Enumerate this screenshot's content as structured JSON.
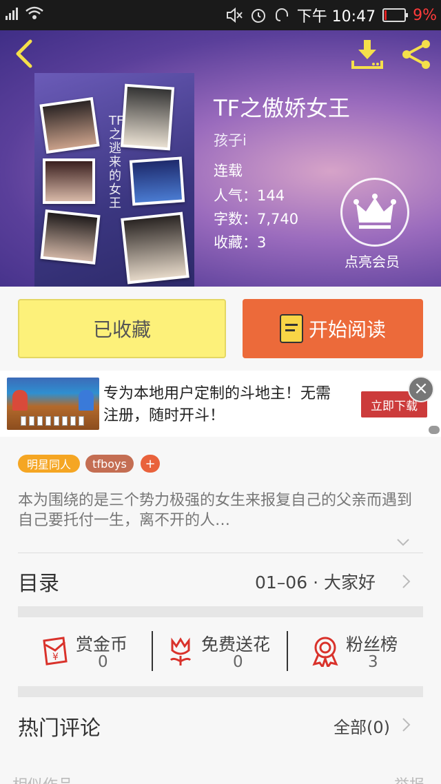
{
  "status_bar": {
    "time": "下午 10:47",
    "battery_percent": "9%",
    "battery_level": 0.09,
    "colors": {
      "background": "#1a1a1a",
      "battery_low": "#ff3b3b"
    }
  },
  "header": {
    "icons": [
      "back-arrow-icon",
      "download-icon",
      "share-icon"
    ],
    "icon_color": "#f5e04a"
  },
  "book": {
    "title": "TF之傲娇女王",
    "author": "孩子i",
    "status": "连载",
    "popularity": "人气：144",
    "word_count": "字数：7,740",
    "favorites": "收藏：3",
    "cover_text": "TF之逃来的女王"
  },
  "vip": {
    "label": "点亮会员",
    "icon": "crown-icon"
  },
  "actions": {
    "collected_label": "已收藏",
    "read_label": "开始阅读",
    "colors": {
      "collected": "#fdf17a",
      "read": "#ec6a3a"
    }
  },
  "ad": {
    "text": "专为本地用户定制的斗地主！无需注册，随时开斗！",
    "button_label": "立即下载",
    "close_icon": "close-icon"
  },
  "tags": {
    "items": [
      "明星同人",
      "tfboys"
    ],
    "add_label": "+"
  },
  "description": "本为围绕的是三个势力极强的女生来报复自己的父亲而遇到自己要托付一生，离不开的人…",
  "toc": {
    "label": "目录",
    "latest": "01–06 · 大家好"
  },
  "stats": {
    "reward": {
      "label": "赏金币",
      "value": "0",
      "icon": "red-envelope-icon"
    },
    "flowers": {
      "label": "免费送花",
      "value": "0",
      "icon": "flower-icon"
    },
    "fans": {
      "label": "粉丝榜",
      "value": "3",
      "icon": "medal-icon"
    },
    "icon_color": "#d9322b"
  },
  "comments": {
    "label": "热门评论",
    "all_label": "全部(0)"
  },
  "similar": {
    "label": "相似作品",
    "report_label": "举报"
  }
}
